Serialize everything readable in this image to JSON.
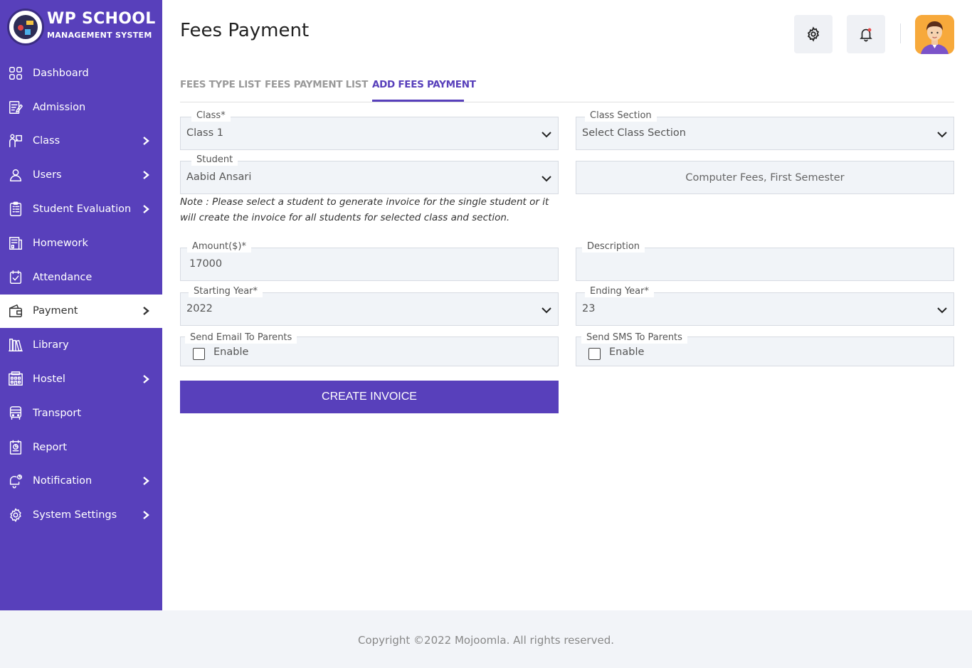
{
  "brand": {
    "title": "WP SCHOOL",
    "subtitle": "MANAGEMENT SYSTEM"
  },
  "sidebar": {
    "items": [
      {
        "label": "Dashboard",
        "icon": "dashboard-icon",
        "chevron": false,
        "active": false
      },
      {
        "label": "Admission",
        "icon": "admission-icon",
        "chevron": false,
        "active": false
      },
      {
        "label": "Class",
        "icon": "class-icon",
        "chevron": true,
        "active": false
      },
      {
        "label": "Users",
        "icon": "users-icon",
        "chevron": true,
        "active": false
      },
      {
        "label": "Student Evaluation",
        "icon": "evaluation-icon",
        "chevron": true,
        "active": false
      },
      {
        "label": "Homework",
        "icon": "homework-icon",
        "chevron": false,
        "active": false
      },
      {
        "label": "Attendance",
        "icon": "attendance-icon",
        "chevron": false,
        "active": false
      },
      {
        "label": "Payment",
        "icon": "wallet-icon",
        "chevron": true,
        "active": true
      },
      {
        "label": "Library",
        "icon": "library-icon",
        "chevron": false,
        "active": false
      },
      {
        "label": "Hostel",
        "icon": "hostel-icon",
        "chevron": true,
        "active": false
      },
      {
        "label": "Transport",
        "icon": "bus-icon",
        "chevron": false,
        "active": false
      },
      {
        "label": "Report",
        "icon": "report-icon",
        "chevron": false,
        "active": false
      },
      {
        "label": "Notification",
        "icon": "notification-icon",
        "chevron": true,
        "active": false
      },
      {
        "label": "System Settings",
        "icon": "settings-icon",
        "chevron": true,
        "active": false
      }
    ]
  },
  "header": {
    "title": "Fees Payment"
  },
  "tabs": [
    {
      "label": "FEES TYPE LIST",
      "active": false
    },
    {
      "label": "FEES PAYMENT LIST",
      "active": false
    },
    {
      "label": "ADD FEES PAYMENT",
      "active": true
    }
  ],
  "form": {
    "class": {
      "label": "Class*",
      "value": "Class 1"
    },
    "class_section": {
      "label": "Class Section",
      "value": "Select Class Section"
    },
    "student": {
      "label": "Student",
      "value": "Aabid Ansari"
    },
    "fees_type": {
      "value": "Computer Fees, First Semester"
    },
    "note": "Note : Please select a student to generate invoice for the single student or it will create the invoice for all students for selected class and section.",
    "amount": {
      "label": "Amount($)*",
      "value": "17000"
    },
    "description": {
      "label": "Description",
      "value": ""
    },
    "starting_year": {
      "label": "Starting Year*",
      "value": "2022"
    },
    "ending_year": {
      "label": "Ending Year*",
      "value": "23"
    },
    "send_email": {
      "label": "Send Email To Parents",
      "option": "Enable",
      "checked": false
    },
    "send_sms": {
      "label": "Send SMS To Parents",
      "option": "Enable",
      "checked": false
    },
    "submit_label": "CREATE INVOICE"
  },
  "colors": {
    "primary": "#5840bb",
    "field_bg": "#f1f4f8",
    "footer_bg": "#f2f4f8"
  },
  "footer": {
    "text": "Copyright ©2022 Mojoomla. All rights reserved."
  }
}
